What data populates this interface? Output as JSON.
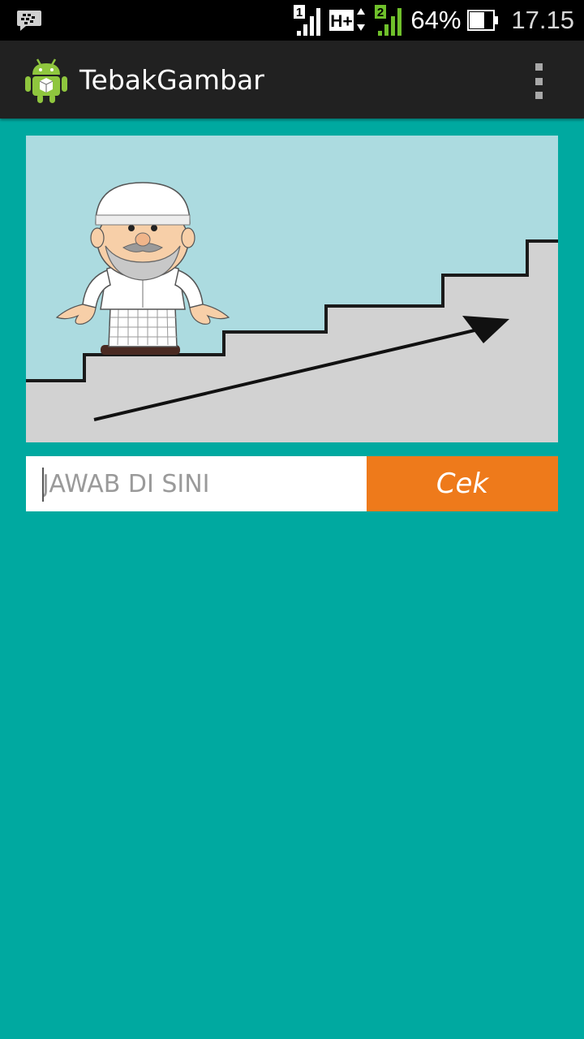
{
  "status_bar": {
    "notification_icon": "bbm-chat-icon",
    "sim1_label": "1",
    "network_label": "H+",
    "sim2_label": "2",
    "battery_text": "64%",
    "battery_level": 0.64,
    "time": "17.15"
  },
  "action_bar": {
    "app_icon": "android-robot-icon",
    "title": "TebakGambar",
    "menu_icon": "overflow-menu-icon"
  },
  "puzzle": {
    "image": "cartoon-man-stairs-arrow-image"
  },
  "answer": {
    "placeholder": "JAWAB DI SINI",
    "value": ""
  },
  "check_button": {
    "label": "Cek"
  },
  "colors": {
    "background": "#00a9a0",
    "action_bar": "#212121",
    "button": "#ee7a1b",
    "sim2_accent": "#6fc02b"
  }
}
